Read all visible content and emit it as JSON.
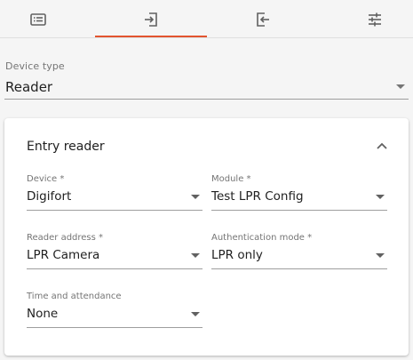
{
  "tabs": [
    {
      "icon": "list-card-icon",
      "active": false
    },
    {
      "icon": "entry-arrow-icon",
      "active": true
    },
    {
      "icon": "exit-arrow-icon",
      "active": false
    },
    {
      "icon": "tune-sliders-icon",
      "active": false
    }
  ],
  "accent_color": "#e2542f",
  "device_type": {
    "label": "Device type",
    "value": "Reader"
  },
  "entry_reader": {
    "title": "Entry reader",
    "fields": {
      "device": {
        "label": "Device *",
        "value": "Digifort"
      },
      "module": {
        "label": "Module *",
        "value": "Test LPR Config"
      },
      "reader_address": {
        "label": "Reader address *",
        "value": "LPR Camera"
      },
      "authentication_mode": {
        "label": "Authentication mode *",
        "value": "LPR only"
      },
      "time_and_attendance": {
        "label": "Time and attendance",
        "value": "None"
      }
    }
  }
}
